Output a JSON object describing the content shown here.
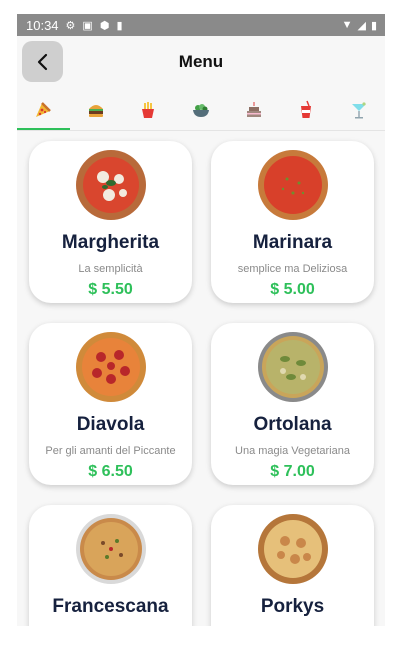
{
  "status": {
    "time": "10:34"
  },
  "header": {
    "title": "Menu"
  },
  "categories": [
    {
      "name": "pizza",
      "active": true
    },
    {
      "name": "burger",
      "active": false
    },
    {
      "name": "fries",
      "active": false
    },
    {
      "name": "salad",
      "active": false
    },
    {
      "name": "cake",
      "active": false
    },
    {
      "name": "drink",
      "active": false
    },
    {
      "name": "cocktail",
      "active": false
    }
  ],
  "items": [
    {
      "name": "Margherita",
      "desc": "La semplicità",
      "price": "$ 5.50"
    },
    {
      "name": "Marinara",
      "desc": "semplice ma Deliziosa",
      "price": "$ 5.00"
    },
    {
      "name": "Diavola",
      "desc": "Per gli amanti del Piccante",
      "price": "$ 6.50"
    },
    {
      "name": "Ortolana",
      "desc": "Una magia Vegetariana",
      "price": "$ 7.00"
    },
    {
      "name": "Francescana",
      "desc": "",
      "price": ""
    },
    {
      "name": "Porkys",
      "desc": "",
      "price": ""
    }
  ],
  "colors": {
    "accent": "#2ec05a",
    "title": "#16213e"
  }
}
